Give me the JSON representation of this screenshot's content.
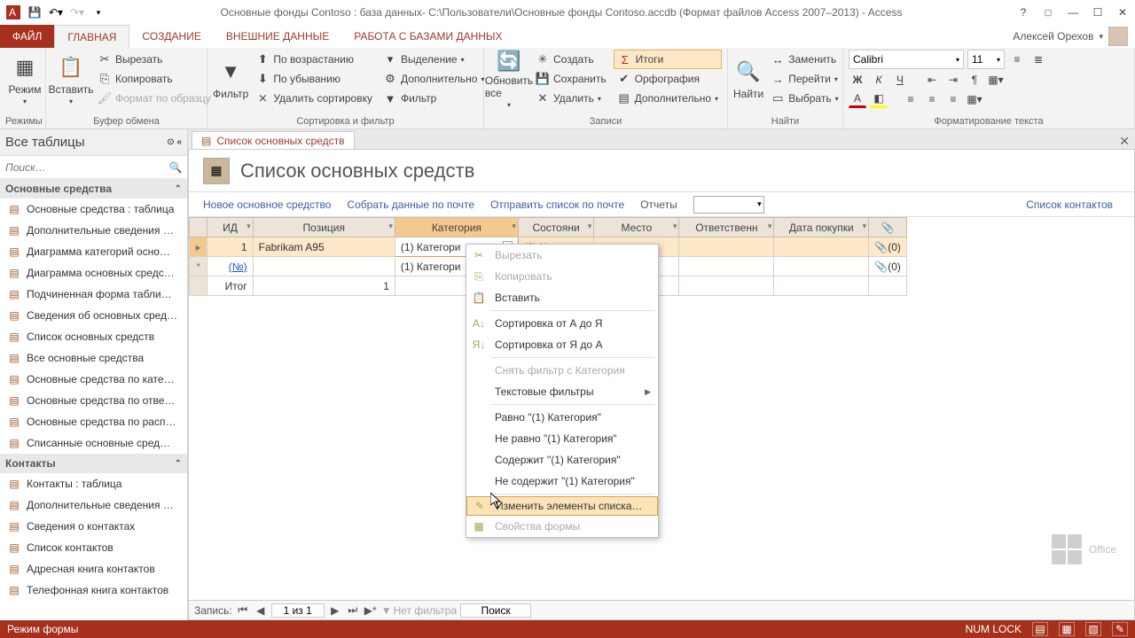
{
  "titlebar": {
    "title": "Основные фонды Contoso : база данных- C:\\Пользователи\\Основные фонды Contoso.accdb (Формат файлов Access 2007–2013) - Access"
  },
  "user": {
    "name": "Алексей Орехов"
  },
  "tabs": {
    "file": "ФАЙЛ",
    "home": "ГЛАВНАЯ",
    "create": "СОЗДАНИЕ",
    "external": "ВНЕШНИЕ ДАННЫЕ",
    "dbtools": "РАБОТА С БАЗАМИ ДАННЫХ"
  },
  "ribbon": {
    "views": {
      "view": "Режим",
      "group": "Режимы"
    },
    "clipboard": {
      "paste": "Вставить",
      "cut": "Вырезать",
      "copy": "Копировать",
      "painter": "Формат по образцу",
      "group": "Буфер обмена"
    },
    "sort": {
      "filter": "Фильтр",
      "asc": "По возрастанию",
      "desc": "По убыванию",
      "clear": "Удалить сортировку",
      "selection": "Выделение",
      "advanced": "Дополнительно",
      "toggle": "Фильтр",
      "group": "Сортировка и фильтр"
    },
    "records": {
      "refresh": "Обновить все",
      "new": "Создать",
      "save": "Сохранить",
      "delete": "Удалить",
      "totals": "Итоги",
      "spelling": "Орфография",
      "more": "Дополнительно",
      "group": "Записи"
    },
    "find": {
      "find": "Найти",
      "replace": "Заменить",
      "goto": "Перейти",
      "select": "Выбрать",
      "group": "Найти"
    },
    "format": {
      "font": "Calibri",
      "size": "11",
      "group": "Форматирование текста"
    }
  },
  "navpane": {
    "title": "Все таблицы",
    "search_placeholder": "Поиск…",
    "groups": [
      {
        "name": "Основные средства",
        "items": [
          "Основные средства : таблица",
          "Дополнительные сведения …",
          "Диаграмма категорий осно…",
          "Диаграмма основных средс…",
          "Подчиненная форма табли…",
          "Сведения об основных сред…",
          "Список основных средств",
          "Все основные средства",
          "Основные средства по кате…",
          "Основные средства по отве…",
          "Основные средства по расп…",
          "Списанные основные сред…"
        ]
      },
      {
        "name": "Контакты",
        "items": [
          "Контакты : таблица",
          "Дополнительные сведения …",
          "Сведения о контактах",
          "Список контактов",
          "Адресная книга контактов",
          "Телефонная книга контактов"
        ]
      }
    ]
  },
  "doc": {
    "tab": "Список основных средств",
    "title": "Список основных средств",
    "toolbar": {
      "new": "Новое основное средство",
      "collect": "Собрать данные по почте",
      "send": "Отправить список по почте",
      "reports_label": "Отчеты",
      "contacts": "Список контактов"
    },
    "columns": [
      "ИД",
      "Позиция",
      "Категория",
      "Состояни",
      "Место",
      "Ответственн",
      "Дата покупки"
    ],
    "rows": [
      {
        "id": "1",
        "item": "Fabrikam A95",
        "category": "(1) Категори",
        "status": "(2) Хорошее",
        "location": "",
        "owner": "",
        "date": "",
        "attach": "(0)"
      },
      {
        "id_link": "(№)",
        "item": "",
        "category": "(1) Категори",
        "status": "",
        "location": "",
        "owner": "",
        "date": "",
        "attach": "(0)"
      }
    ],
    "totals": {
      "label": "Итог",
      "count": "1"
    }
  },
  "context_menu": {
    "cut": "Вырезать",
    "copy": "Копировать",
    "paste": "Вставить",
    "sort_az": "Сортировка от А до Я",
    "sort_za": "Сортировка от Я до А",
    "clear_filter": "Снять фильтр с Категория",
    "text_filters": "Текстовые фильтры",
    "equals": "Равно \"(1) Категория\"",
    "not_equals": "Не равно \"(1) Категория\"",
    "contains": "Содержит \"(1) Категория\"",
    "not_contains": "Не содержит \"(1) Категория\"",
    "edit_list": "Изменить элементы списка…",
    "form_props": "Свойства формы"
  },
  "recnav": {
    "label": "Запись:",
    "pos": "1 из 1",
    "no_filter": "Нет фильтра",
    "search": "Поиск"
  },
  "status": {
    "mode": "Режим формы",
    "numlock": "NUM LOCK"
  },
  "watermark": "Office"
}
